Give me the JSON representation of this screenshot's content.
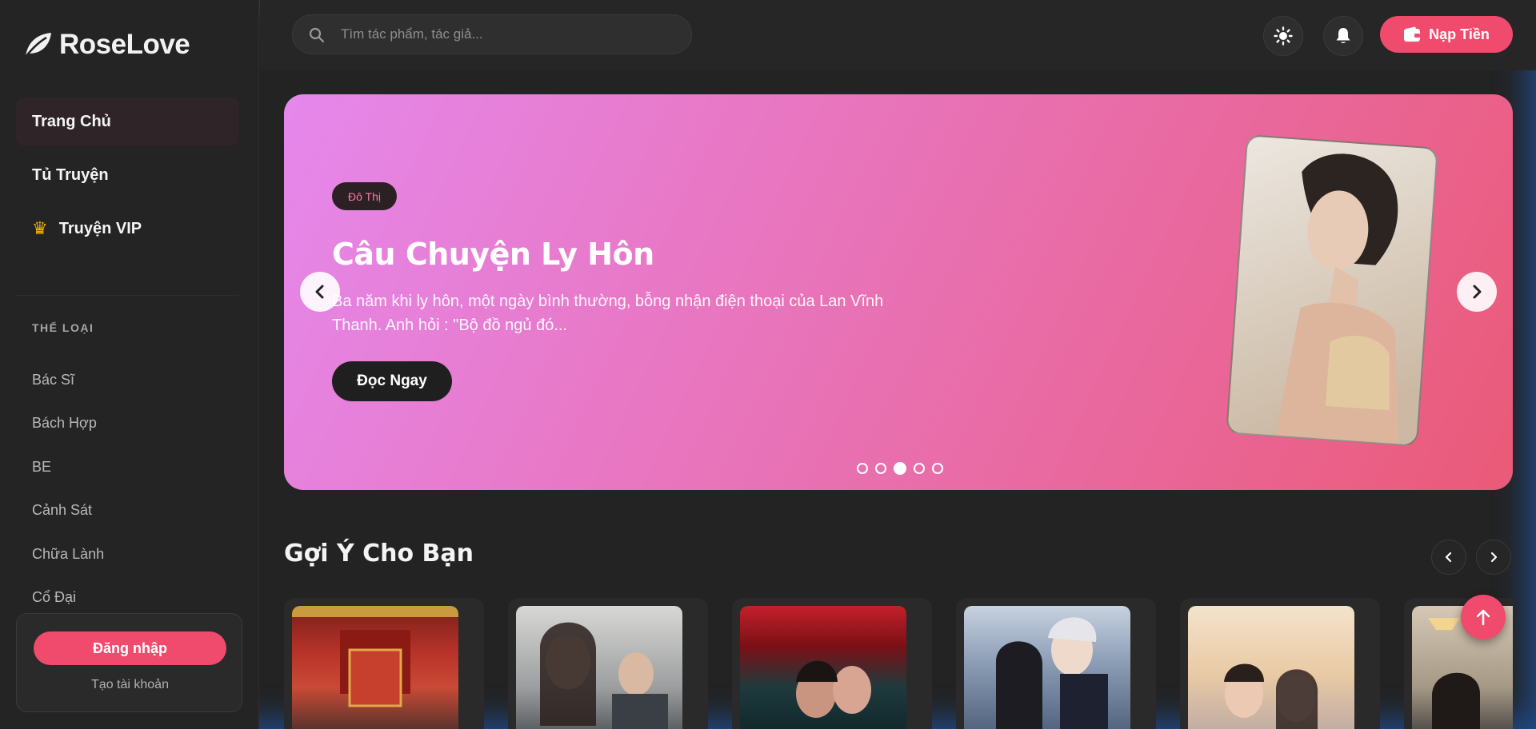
{
  "brand": {
    "name": "RoseLove"
  },
  "nav": {
    "items": [
      {
        "label": "Trang Chủ",
        "active": true
      },
      {
        "label": "Tủ Truyện",
        "active": false
      },
      {
        "label": "Truyện VIP",
        "active": false,
        "icon": "crown-icon"
      }
    ]
  },
  "genres": {
    "title": "THỂ LOẠI",
    "items": [
      "Bác Sĩ",
      "Bách Hợp",
      "BE",
      "Cảnh Sát",
      "Chữa Lành",
      "Cổ Đại"
    ]
  },
  "auth": {
    "login_label": "Đăng nhập",
    "register_label": "Tạo tài khoản"
  },
  "header": {
    "search_placeholder": "Tìm tác phẩm, tác giả...",
    "topup_label": "Nạp Tiền"
  },
  "hero": {
    "badge": "Đô Thị",
    "title": "Câu Chuyện Ly Hôn",
    "description": "Ba năm khi ly hôn, một ngày bình thường, bỗng nhận điện thoại của Lan Vĩnh Thanh.   Anh hỏi : \"Bộ đồ ngủ đó...",
    "read_label": "Đọc Ngay",
    "slide_count": 5,
    "active_slide": 3
  },
  "recommend": {
    "title": "Gợi Ý Cho Bạn"
  },
  "colors": {
    "accent": "#f04a6c",
    "background": "#232323",
    "sidebar": "#242424"
  }
}
